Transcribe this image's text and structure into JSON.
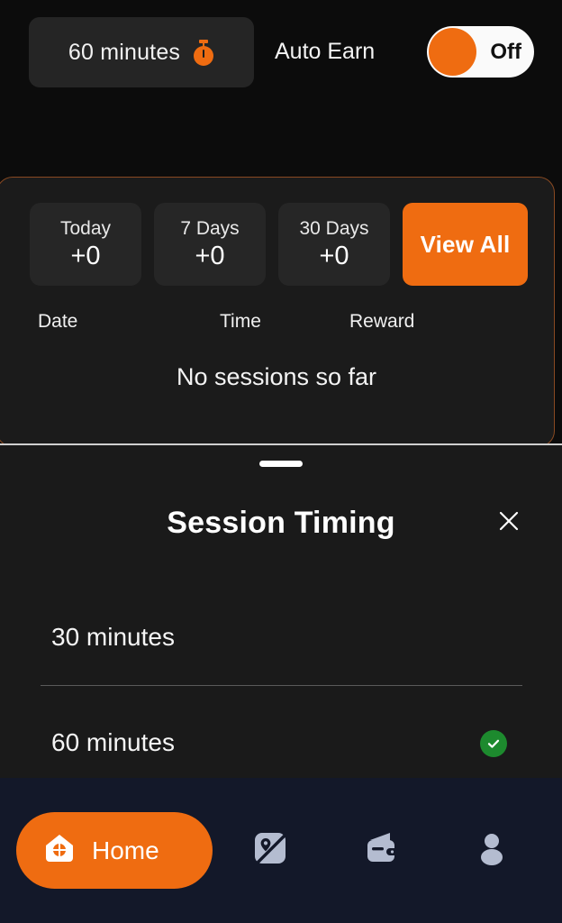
{
  "theme": {
    "accent": "#ef6c11",
    "page_bg": "#0c0c0c",
    "card_bg": "#1b1b1b",
    "sheet_bg": "#1a1a1a",
    "nav_bg": "#131829",
    "success": "#1d8a2e",
    "nav_icon": "#b4bcd0",
    "card_border": "#8a4a22"
  },
  "topbar": {
    "timing_label": "60 minutes",
    "timing_icon": "stopwatch-icon",
    "auto_earn_label": "Auto Earn",
    "toggle_state": "Off",
    "toggle_on": false
  },
  "sessions": {
    "stats": [
      {
        "label": "Today",
        "value": "+0"
      },
      {
        "label": "7 Days",
        "value": "+0"
      },
      {
        "label": "30 Days",
        "value": "+0"
      }
    ],
    "view_all_label": "View All",
    "columns": [
      "Date",
      "Time",
      "Reward"
    ],
    "empty_message": "No sessions so far",
    "rows": []
  },
  "sheet": {
    "title": "Session Timing",
    "close_icon": "close-icon",
    "handle_icon": "drag-handle",
    "options": [
      {
        "label": "30 minutes",
        "selected": false
      },
      {
        "label": "60 minutes",
        "selected": true
      }
    ]
  },
  "bottom_nav": {
    "items": [
      {
        "label": "Home",
        "icon": "home-icon",
        "active": true
      },
      {
        "label": "",
        "icon": "map-pin-icon",
        "active": false
      },
      {
        "label": "",
        "icon": "wallet-icon",
        "active": false
      },
      {
        "label": "",
        "icon": "profile-icon",
        "active": false
      }
    ]
  }
}
